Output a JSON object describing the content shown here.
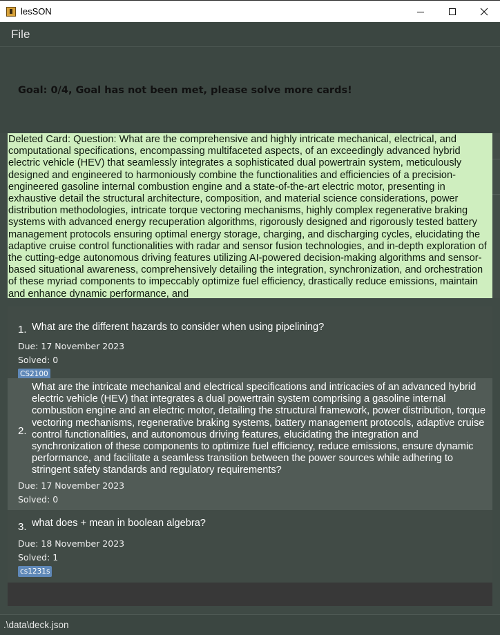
{
  "window": {
    "title": "lesSON",
    "minimize_icon": "minimize-icon",
    "maximize_icon": "maximize-icon",
    "close_icon": "close-icon"
  },
  "menu": {
    "file": "File"
  },
  "goal": {
    "text": "Goal: 0/4, Goal has not been met, please solve more cards!"
  },
  "result": {
    "text": "Deleted Card: Question: What are the comprehensive and highly intricate mechanical, electrical, and computational specifications, encompassing multifaceted aspects, of an exceedingly advanced hybrid electric vehicle (HEV) that seamlessly integrates a sophisticated dual powertrain system, meticulously designed and engineered to harmoniously combine the functionalities and efficiencies of a precision-engineered gasoline internal combustion engine and a state-of-the-art electric motor, presenting in exhaustive detail the structural architecture, composition, and material science considerations, power distribution methodologies, intricate torque vectoring mechanisms, highly complex regenerative braking systems with advanced energy recuperation algorithms, rigorously designed and rigorously tested battery management protocols ensuring optimal energy storage, charging, and discharging cycles, elucidating the adaptive cruise control functionalities with radar and sensor fusion technologies, and in-depth exploration of the cutting-edge autonomous driving features utilizing AI-powered decision-making algorithms and sensor-based situational awareness, comprehensively detailing the integration, synchronization, and orchestration of these myriad components to impeccably optimize fuel efficiency, drastically reduce emissions, maintain and enhance dynamic performance, and"
  },
  "cards": [
    {
      "number": "1.",
      "question": "What are the different hazards to consider when using pipelining?",
      "due": "Due: 17 November 2023",
      "solved": "Solved: 0",
      "tag": "CS2100"
    },
    {
      "number": "2.",
      "question": "What are the intricate mechanical and electrical specifications and intricacies of an advanced hybrid electric vehicle (HEV) that integrates a dual powertrain system comprising a gasoline internal combustion engine and an electric motor, detailing the structural framework, power distribution, torque vectoring mechanisms, regenerative braking systems, battery management protocols, adaptive cruise control functionalities, and autonomous driving features, elucidating the integration and synchronization of these components to optimize fuel efficiency, reduce emissions, ensure dynamic performance, and facilitate a seamless transition between the power sources while adhering to stringent safety standards and regulatory requirements?",
      "due": "Due: 17 November 2023",
      "solved": "Solved: 0"
    },
    {
      "number": "3.",
      "question": "what does + mean in boolean algebra?",
      "due": "Due: 18 November 2023",
      "solved": "Solved: 1",
      "tag": "cs1231s"
    }
  ],
  "status": {
    "path": ".\\data\\deck.json"
  }
}
